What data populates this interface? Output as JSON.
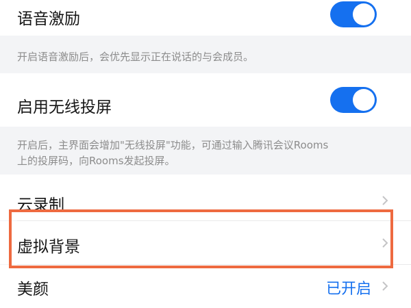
{
  "settings": {
    "voice_motivation": {
      "label": "语音激励",
      "enabled": true,
      "description": "开启语音激励后，会优先显示正在说话的与会成员。"
    },
    "wireless_cast": {
      "label": "启用无线投屏",
      "enabled": true,
      "description_line1": "开启后，主界面会增加\"无线投屏\"功能，可通过输入腾讯会议Rooms",
      "description_line2": "上的投屏码，向Rooms发起投屏。"
    },
    "cloud_record": {
      "label": "云录制"
    },
    "virtual_background": {
      "label": "虚拟背景"
    },
    "beauty": {
      "label": "美颜",
      "status": "已开启"
    }
  },
  "colors": {
    "accent": "#1570ef",
    "highlight": "#ee6a40"
  }
}
